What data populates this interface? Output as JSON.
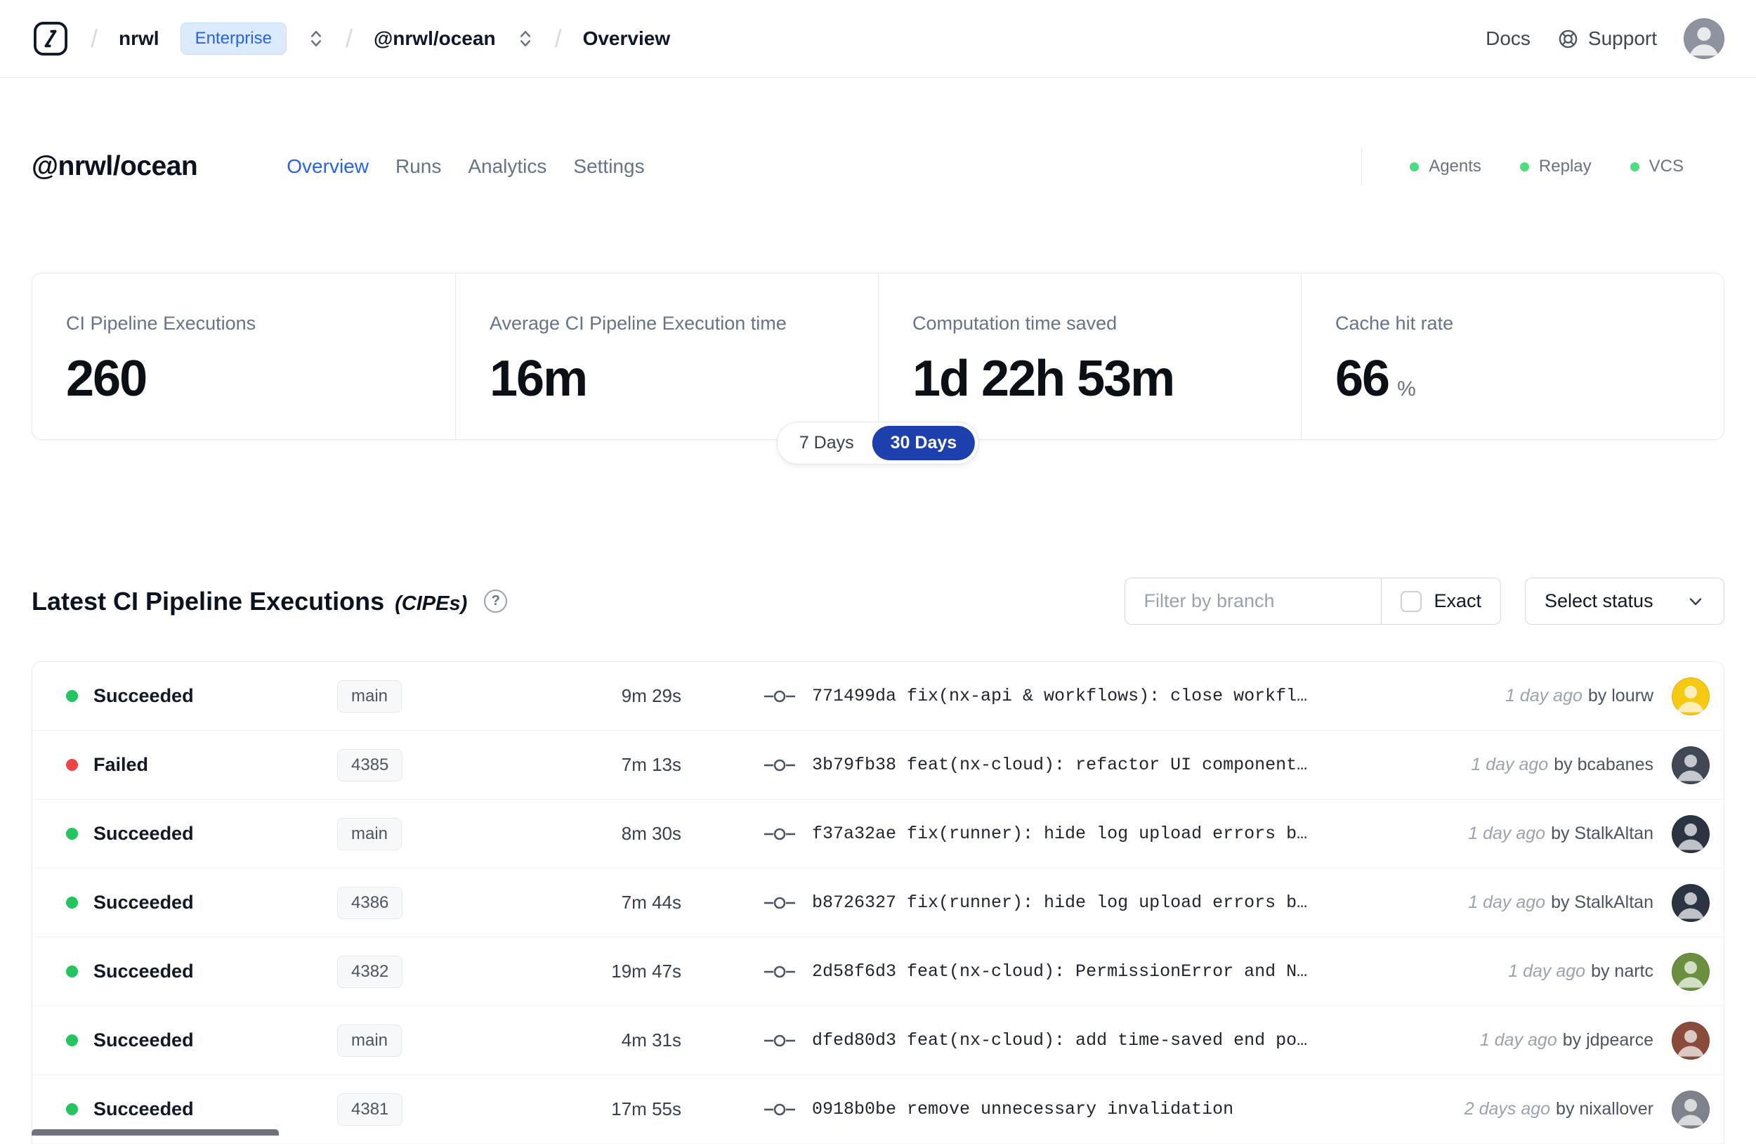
{
  "colors": {
    "accent_blue": "#2563eb",
    "toggle_active_bg": "#1e40af",
    "success_green": "#22c55e",
    "failed_red": "#ef4444",
    "indicator_green": "#4ade80"
  },
  "navbar": {
    "separator": "/",
    "org": "nrwl",
    "plan_badge": "Enterprise",
    "workspace": "@nrwl/ocean",
    "page": "Overview",
    "docs": "Docs",
    "support": "Support"
  },
  "header": {
    "title": "@nrwl/ocean",
    "tabs": [
      {
        "label": "Overview",
        "active": true
      },
      {
        "label": "Runs",
        "active": false
      },
      {
        "label": "Analytics",
        "active": false
      },
      {
        "label": "Settings",
        "active": false
      }
    ],
    "indicators": [
      {
        "label": "Agents"
      },
      {
        "label": "Replay"
      },
      {
        "label": "VCS"
      }
    ]
  },
  "stats": {
    "cards": [
      {
        "label": "CI Pipeline Executions",
        "value": "260",
        "unit": ""
      },
      {
        "label": "Average CI Pipeline Execution time",
        "value": "16m",
        "unit": ""
      },
      {
        "label": "Computation time saved",
        "value": "1d 22h 53m",
        "unit": ""
      },
      {
        "label": "Cache hit rate",
        "value": "66",
        "unit": "%"
      }
    ],
    "toggle": {
      "options": [
        "7 Days",
        "30 Days"
      ],
      "selected": "30 Days"
    }
  },
  "cipe": {
    "title": "Latest CI Pipeline Executions",
    "suffix": "(CIPEs)",
    "help_glyph": "?",
    "filter_placeholder": "Filter by branch",
    "exact_label": "Exact",
    "select_status_label": "Select status",
    "rows": [
      {
        "status": "Succeeded",
        "status_color": "#22c55e",
        "branch": "main",
        "duration": "9m 29s",
        "commit": "771499da fix(nx-api & workflows): close workfl…",
        "time_ago": "1 day ago",
        "author": "by lourw",
        "avatar_color": "#f6c915"
      },
      {
        "status": "Failed",
        "status_color": "#ef4444",
        "branch": "4385",
        "duration": "7m 13s",
        "commit": "3b79fb38 feat(nx-cloud): refactor UI component…",
        "time_ago": "1 day ago",
        "author": "by bcabanes",
        "avatar_color": "#3f4854"
      },
      {
        "status": "Succeeded",
        "status_color": "#22c55e",
        "branch": "main",
        "duration": "8m 30s",
        "commit": "f37a32ae fix(runner): hide log upload errors b…",
        "time_ago": "1 day ago",
        "author": "by StalkAltan",
        "avatar_color": "#2b3442"
      },
      {
        "status": "Succeeded",
        "status_color": "#22c55e",
        "branch": "4386",
        "duration": "7m 44s",
        "commit": "b8726327 fix(runner): hide log upload errors b…",
        "time_ago": "1 day ago",
        "author": "by StalkAltan",
        "avatar_color": "#2b3442"
      },
      {
        "status": "Succeeded",
        "status_color": "#22c55e",
        "branch": "4382",
        "duration": "19m 47s",
        "commit": "2d58f6d3 feat(nx-cloud): PermissionError and N…",
        "time_ago": "1 day ago",
        "author": "by nartc",
        "avatar_color": "#6a8f3f"
      },
      {
        "status": "Succeeded",
        "status_color": "#22c55e",
        "branch": "main",
        "duration": "4m 31s",
        "commit": "dfed80d3 feat(nx-cloud): add time-saved end po…",
        "time_ago": "1 day ago",
        "author": "by jdpearce",
        "avatar_color": "#8a4b3a"
      },
      {
        "status": "Succeeded",
        "status_color": "#22c55e",
        "branch": "4381",
        "duration": "17m 55s",
        "commit": "0918b0be remove unnecessary invalidation",
        "time_ago": "2 days ago",
        "author": "by nixallover",
        "avatar_color": "#7d828b"
      }
    ]
  }
}
